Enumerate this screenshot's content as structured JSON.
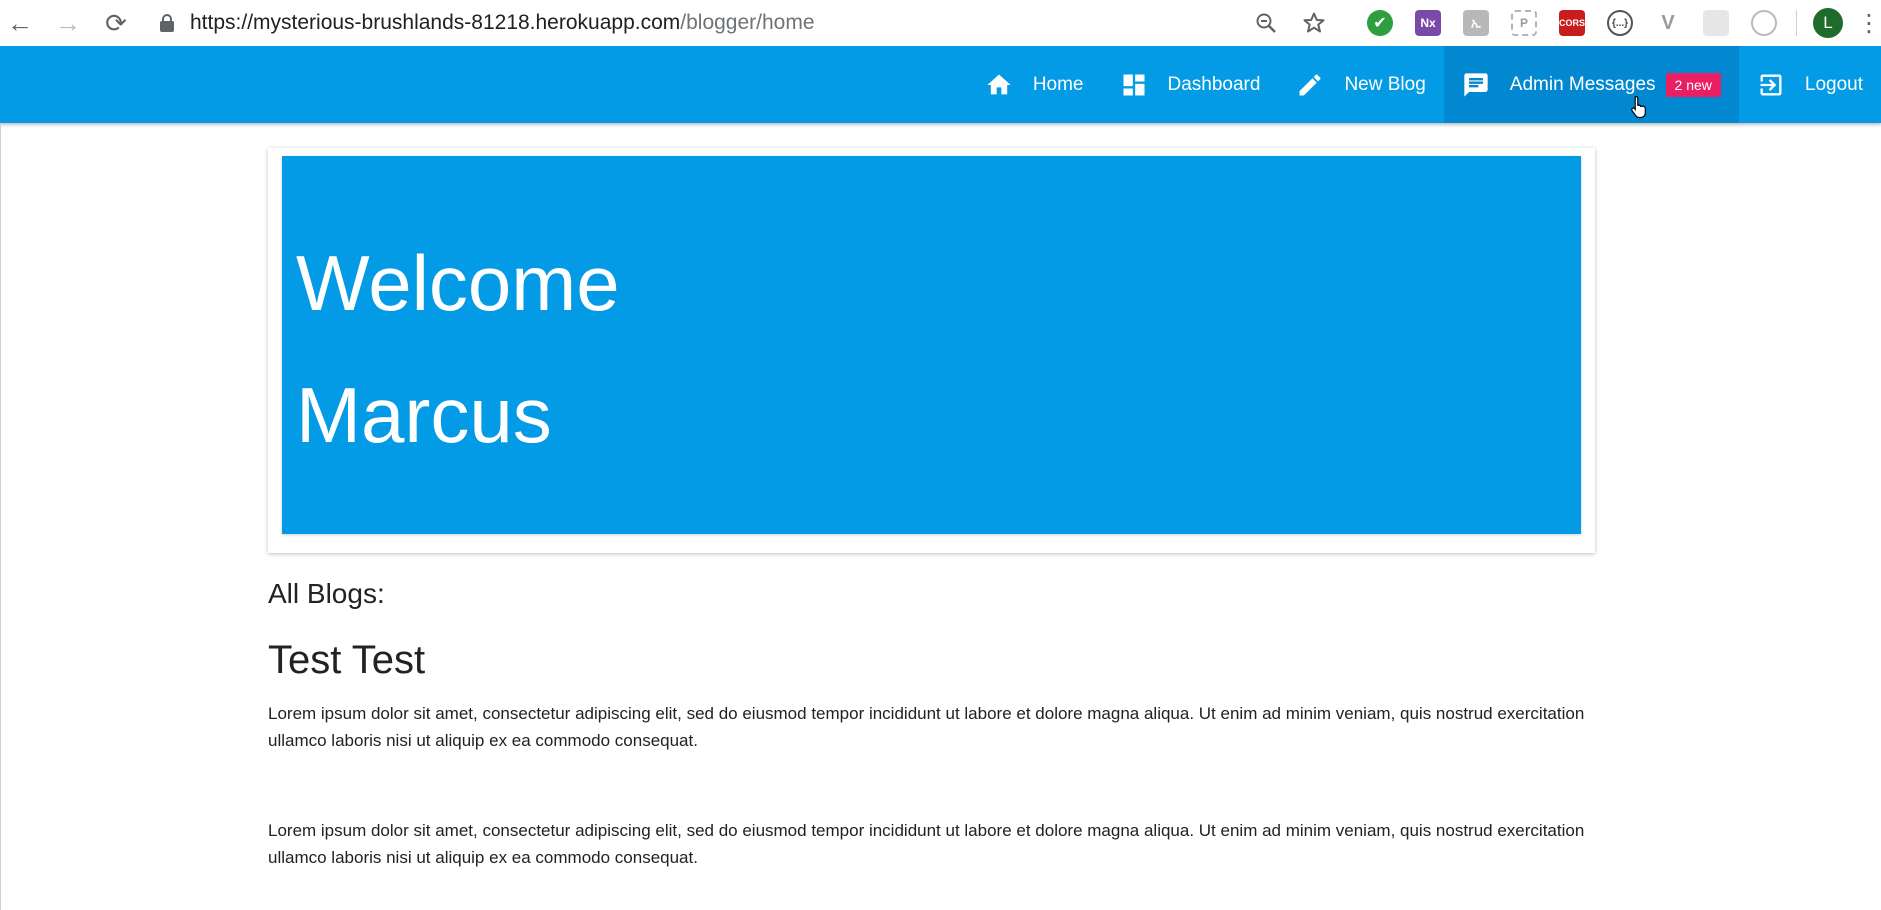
{
  "browser": {
    "url_host": "https://mysterious-brushlands-81218.herokuapp.com",
    "url_path": "/blogger/home",
    "back_icon": "arrow-left-icon",
    "forward_icon": "arrow-right-icon",
    "reload_icon": "reload-icon",
    "extensions": [
      {
        "name": "check-extension",
        "label": "✔"
      },
      {
        "name": "nx-extension",
        "label": "Nx"
      },
      {
        "name": "grey-extension",
        "label": "ኢ"
      },
      {
        "name": "dashed-extension",
        "label": "P"
      },
      {
        "name": "cors-extension",
        "label": "CORS"
      },
      {
        "name": "json-extension",
        "label": "{...}"
      },
      {
        "name": "vue-extension",
        "label": "V"
      },
      {
        "name": "light-extension",
        "label": ""
      },
      {
        "name": "target-extension",
        "label": ""
      }
    ],
    "profile_initial": "L"
  },
  "navbar": {
    "color": "#039be5",
    "items": [
      {
        "label": "Home",
        "icon": "home-icon"
      },
      {
        "label": "Dashboard",
        "icon": "dashboard-icon"
      },
      {
        "label": "New Blog",
        "icon": "pencil-icon"
      },
      {
        "label": "Admin Messages",
        "icon": "message-icon",
        "badge": "2 new",
        "active": true
      },
      {
        "label": "Logout",
        "icon": "logout-icon"
      }
    ]
  },
  "hero": {
    "line1": "Welcome",
    "line2": "Marcus"
  },
  "blogs": {
    "section_title": "All Blogs:",
    "items": [
      {
        "title": "Test Test",
        "paragraphs": [
          "Lorem ipsum dolor sit amet, consectetur adipiscing elit, sed do eiusmod tempor incididunt ut labore et dolore magna aliqua. Ut enim ad minim veniam, quis nostrud exercitation ullamco laboris nisi ut aliquip ex ea commodo consequat.",
          "Lorem ipsum dolor sit amet, consectetur adipiscing elit, sed do eiusmod tempor incididunt ut labore et dolore magna aliqua. Ut enim ad minim veniam, quis nostrud exercitation ullamco laboris nisi ut aliquip ex ea commodo consequat."
        ]
      }
    ]
  }
}
